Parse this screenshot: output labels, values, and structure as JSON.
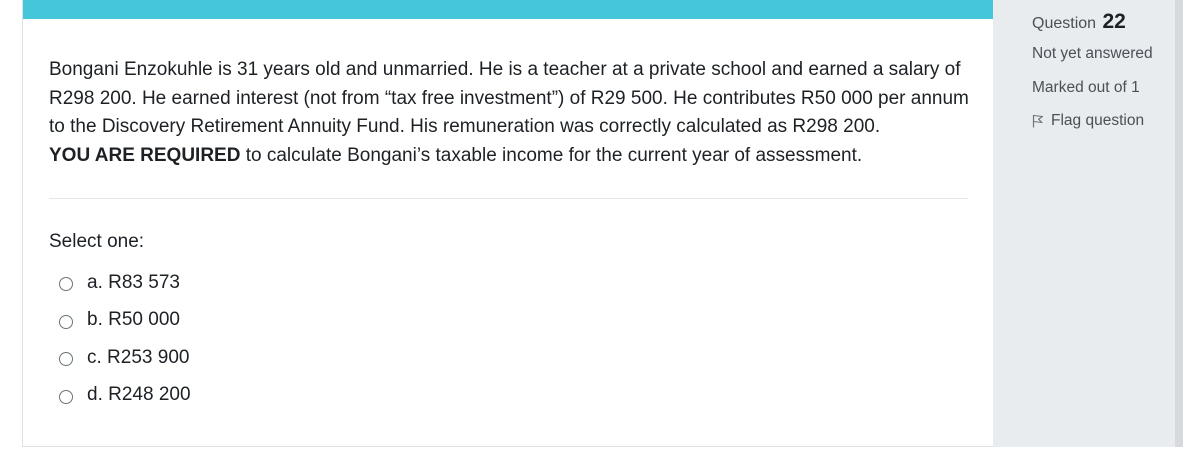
{
  "question": {
    "text_part1": "Bongani Enzokuhle is 31 years old and unmarried. He is a teacher at a private school and earned a salary of R298 200. He earned interest (not from “tax free investment”) of R29 500. He contributes R50 000 per annum to the Discovery Retirement Annuity Fund. His remuneration was correctly calculated as R298 200.",
    "text_required": "YOU ARE REQUIRED",
    "text_part2": " to calculate Bongani’s taxable income for the current year of assessment.",
    "select_prompt": "Select one:",
    "answers": [
      {
        "label": "a. R83 573"
      },
      {
        "label": "b. R50 000"
      },
      {
        "label": "c. R253 900"
      },
      {
        "label": "d. R248 200"
      }
    ]
  },
  "info": {
    "question_label": "Question",
    "question_number": "22",
    "status": "Not yet answered",
    "marks": "Marked out of 1",
    "flag_label": "Flag question",
    "flag_icon": "flag-outline-icon"
  },
  "colors": {
    "accent_bar": "#45c6d9",
    "info_panel_bg": "#e9ecef"
  }
}
